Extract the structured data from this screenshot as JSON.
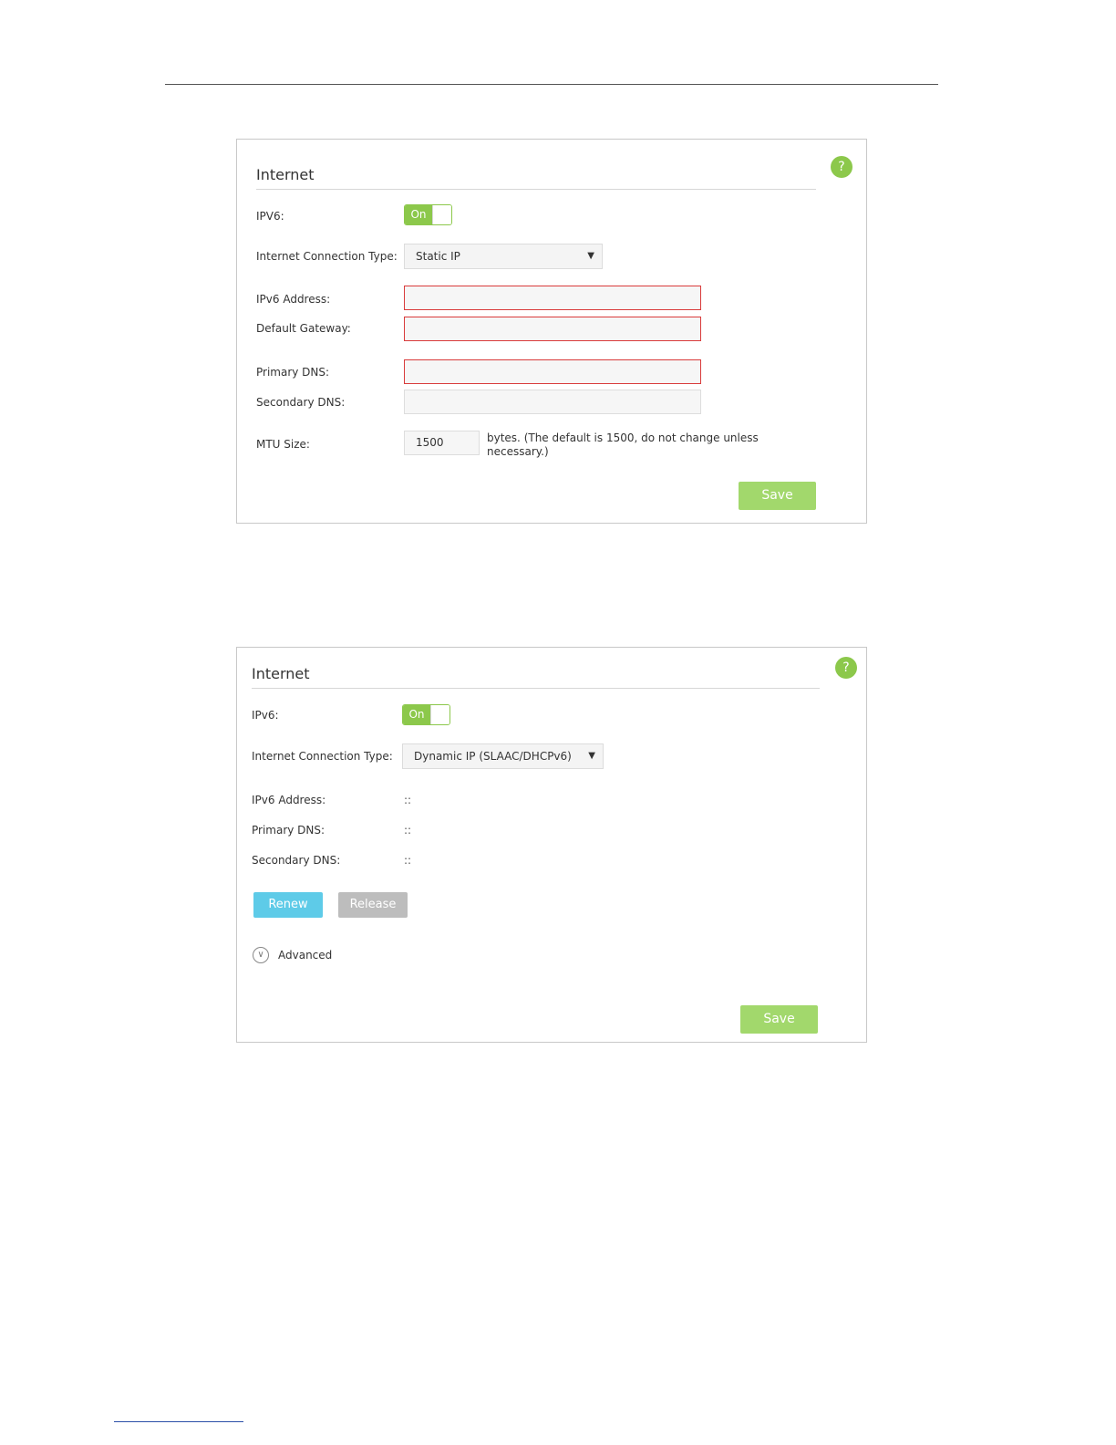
{
  "panels": [
    {
      "title": "Internet",
      "help_icon": "?",
      "ipv6_label": "IPV6:",
      "ipv6_toggle": "On",
      "conn_type_label": "Internet Connection Type:",
      "conn_type_value": "Static IP",
      "ipv6_address_label": "IPv6 Address:",
      "default_gateway_label": "Default Gateway:",
      "primary_dns_label": "Primary DNS:",
      "secondary_dns_label": "Secondary DNS:",
      "mtu_label": "MTU Size:",
      "mtu_value": "1500",
      "mtu_note_line1": "bytes. (The default is 1500, do not change unless",
      "mtu_note_line2": "necessary.)",
      "save_label": "Save"
    },
    {
      "title": "Internet",
      "help_icon": "?",
      "ipv6_label": "IPv6:",
      "ipv6_toggle": "On",
      "conn_type_label": "Internet Connection Type:",
      "conn_type_value": "Dynamic IP (SLAAC/DHCPv6)",
      "ipv6_address_label": "IPv6 Address:",
      "ipv6_address_value": "::",
      "primary_dns_label": "Primary DNS:",
      "primary_dns_value": "::",
      "secondary_dns_label": "Secondary DNS:",
      "secondary_dns_value": "::",
      "renew_label": "Renew",
      "release_label": "Release",
      "advanced_label": "Advanced",
      "save_label": "Save"
    }
  ],
  "colors": {
    "accent_green": "#8cc84b",
    "save_green": "#a2d86c",
    "renew_blue": "#5ecbe8",
    "release_gray": "#bdbdbd",
    "error_red": "#d93b3b"
  },
  "icons": {
    "help": "help-icon",
    "dropdown": "chevron-down-icon",
    "advanced": "expand-circle-icon"
  }
}
